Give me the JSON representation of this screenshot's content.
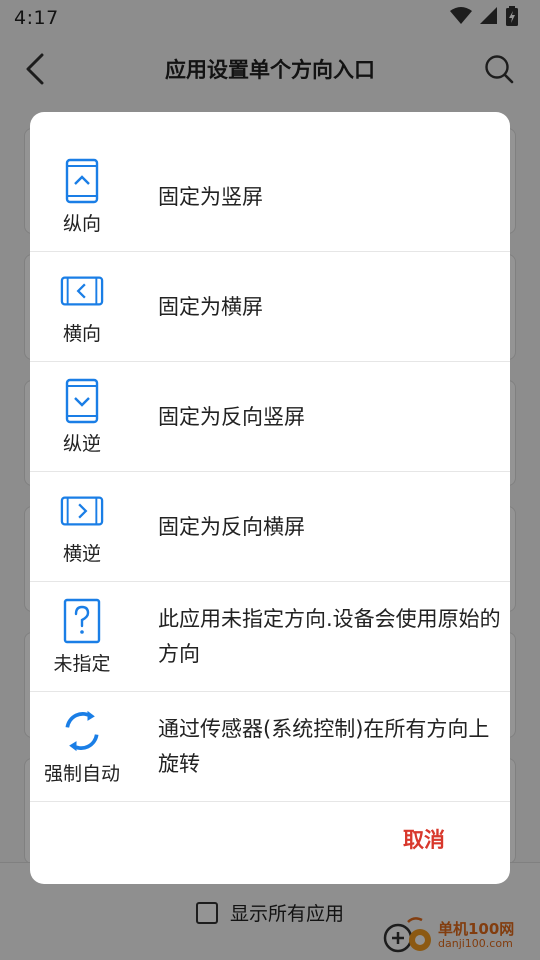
{
  "status": {
    "time": "4:17"
  },
  "toolbar": {
    "title": "应用设置单个方向入口"
  },
  "footer": {
    "show_all_label": "显示所有应用"
  },
  "watermark": {
    "main": "单机100网",
    "sub": "danji100.com"
  },
  "dialog": {
    "options": [
      {
        "icon": "portrait-icon",
        "short_label": "纵向",
        "text": "固定为竖屏"
      },
      {
        "icon": "landscape-icon",
        "short_label": "横向",
        "text": "固定为横屏"
      },
      {
        "icon": "reverse-portrait-icon",
        "short_label": "纵逆",
        "text": "固定为反向竖屏"
      },
      {
        "icon": "reverse-landscape-icon",
        "short_label": "横逆",
        "text": "固定为反向横屏"
      },
      {
        "icon": "unspecified-icon",
        "short_label": "未指定",
        "text": "此应用未指定方向.设备会使用原始的方向"
      },
      {
        "icon": "auto-rotate-icon",
        "short_label": "强制自动",
        "text": "通过传感器(系统控制)在所有方向上旋转"
      }
    ],
    "cancel_label": "取消"
  },
  "colors": {
    "accent": "#1a7ee6",
    "cancel": "#d8382c"
  }
}
